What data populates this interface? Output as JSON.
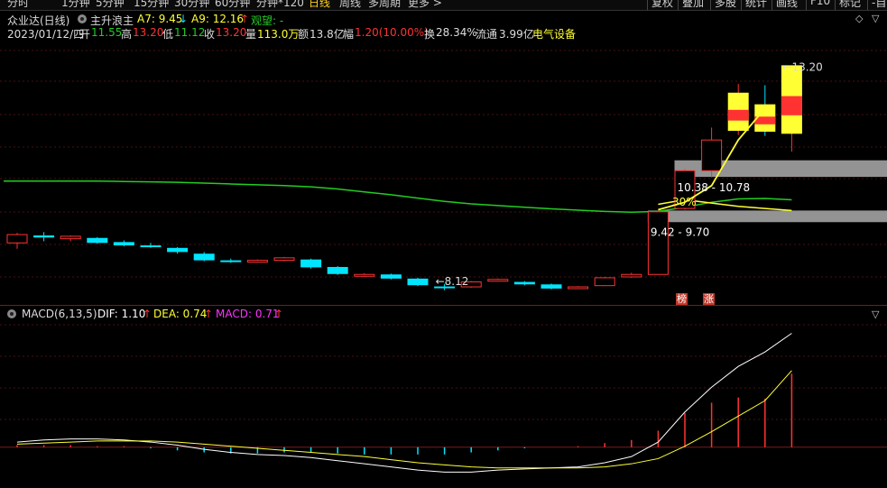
{
  "toolbar": {
    "tabs": [
      "分时",
      "1分钟",
      "5分钟",
      "15分钟",
      "30分钟",
      "60分钟",
      "分钟*120",
      "日线",
      "周线",
      "多周期",
      "更多 >"
    ],
    "active_tab": "日线",
    "right_buttons": [
      "复权",
      "叠加",
      "多股",
      "统计",
      "画线",
      "F10",
      "标记",
      "-自"
    ]
  },
  "header": {
    "stock_name": "众业达(日线)",
    "indicator_name": "主升浪主",
    "a7_label": "A7: 9.45",
    "a7_arrow": "↓",
    "a9_label": "A9: 12.16",
    "a9_arrow": "↑",
    "watch_label": "观望: -",
    "date": "2023/01/12/四",
    "open_label": "开",
    "open_value": "11.55",
    "high_label": "高",
    "high_value": "13.20",
    "low_label": "低",
    "low_value": "11.12",
    "close_label": "收",
    "close_value": "13.20",
    "volume_label": "量",
    "volume_value": "113.0万",
    "amount_label": "额",
    "amount_value": "13.8亿",
    "change_label": "幅",
    "change_value": "1.20(10.00%)",
    "turnover_label": "换",
    "turnover_value": "28.34%",
    "float_label": "流通",
    "float_value": "3.99亿",
    "sector": "电气设备"
  },
  "macd_header": {
    "name": "MACD(6,13,5)",
    "dif_label": "DIF: 1.10",
    "dif_arrow": "↑",
    "dea_label": "DEA: 0.74",
    "dea_arrow": "↑",
    "macd_label": "MACD: 0.71",
    "macd_arrow": "↑"
  },
  "badges": {
    "bang": "榜",
    "zhang": "涨"
  },
  "colors": {
    "up": "#ff3232",
    "down": "#00e5ff",
    "ma_line": "#22cc22",
    "signal_line": "#ffff33",
    "yellow_candle": "#ffff33",
    "band": "#9b9b9b",
    "dif": "#ffffff",
    "dea": "#ffff33",
    "macd_label": "#ff33ff"
  },
  "chart_data": [
    {
      "type": "candlestick",
      "title": "众业达(日线)",
      "ohlc": [
        {
          "o": 8.92,
          "h": 9.16,
          "l": 8.78,
          "c": 9.12
        },
        {
          "o": 9.1,
          "h": 9.18,
          "l": 8.96,
          "c": 9.05
        },
        {
          "o": 9.02,
          "h": 9.1,
          "l": 8.96,
          "c": 9.08
        },
        {
          "o": 9.04,
          "h": 9.06,
          "l": 8.9,
          "c": 8.92
        },
        {
          "o": 8.94,
          "h": 8.98,
          "l": 8.84,
          "c": 8.86
        },
        {
          "o": 8.86,
          "h": 8.92,
          "l": 8.8,
          "c": 8.82
        },
        {
          "o": 8.8,
          "h": 8.82,
          "l": 8.66,
          "c": 8.7
        },
        {
          "o": 8.66,
          "h": 8.7,
          "l": 8.48,
          "c": 8.5
        },
        {
          "o": 8.5,
          "h": 8.54,
          "l": 8.44,
          "c": 8.48
        },
        {
          "o": 8.48,
          "h": 8.52,
          "l": 8.45,
          "c": 8.5
        },
        {
          "o": 8.5,
          "h": 8.58,
          "l": 8.48,
          "c": 8.56
        },
        {
          "o": 8.52,
          "h": 8.54,
          "l": 8.3,
          "c": 8.33
        },
        {
          "o": 8.34,
          "h": 8.36,
          "l": 8.15,
          "c": 8.17
        },
        {
          "o": 8.13,
          "h": 8.19,
          "l": 8.1,
          "c": 8.16
        },
        {
          "o": 8.16,
          "h": 8.18,
          "l": 8.04,
          "c": 8.06
        },
        {
          "o": 8.06,
          "h": 8.08,
          "l": 7.88,
          "c": 7.9
        },
        {
          "o": 7.87,
          "h": 7.93,
          "l": 7.78,
          "c": 7.86
        },
        {
          "o": 7.86,
          "h": 8.0,
          "l": 7.84,
          "c": 7.98
        },
        {
          "o": 8.02,
          "h": 8.06,
          "l": 7.99,
          "c": 8.04
        },
        {
          "o": 7.98,
          "h": 8.0,
          "l": 7.9,
          "c": 7.92
        },
        {
          "o": 7.92,
          "h": 7.94,
          "l": 7.8,
          "c": 7.82
        },
        {
          "o": 7.84,
          "h": 7.88,
          "l": 7.82,
          "c": 7.86
        },
        {
          "o": 7.89,
          "h": 8.1,
          "l": 7.88,
          "c": 8.08
        },
        {
          "o": 8.1,
          "h": 8.2,
          "l": 8.08,
          "c": 8.16
        },
        {
          "o": 8.16,
          "h": 9.7,
          "l": 8.16,
          "c": 9.67
        },
        {
          "o": 9.75,
          "h": 10.7,
          "l": 9.72,
          "c": 10.66
        },
        {
          "o": 10.66,
          "h": 11.7,
          "l": 10.5,
          "c": 11.4
        },
        {
          "o": 11.62,
          "h": 12.75,
          "l": 11.52,
          "c": 12.54,
          "highlight": "yellow"
        },
        {
          "o": 12.26,
          "h": 12.72,
          "l": 11.5,
          "c": 11.6,
          "highlight": "yellow"
        },
        {
          "o": 11.55,
          "h": 13.2,
          "l": 11.12,
          "c": 13.2,
          "highlight": "yellow"
        }
      ],
      "ma_line": [
        10.41,
        10.41,
        10.41,
        10.41,
        10.4,
        10.39,
        10.38,
        10.36,
        10.34,
        10.32,
        10.3,
        10.27,
        10.22,
        10.15,
        10.08,
        10.0,
        9.92,
        9.86,
        9.82,
        9.78,
        9.74,
        9.71,
        9.68,
        9.66,
        9.68,
        9.78,
        9.9,
        9.98,
        9.99,
        9.96
      ],
      "signal_line": [
        {
          "i": 24,
          "v": 9.72
        },
        {
          "i": 25,
          "v": 9.9
        },
        {
          "i": 26,
          "v": 10.3
        },
        {
          "i": 27,
          "v": 11.4
        },
        {
          "i": 28,
          "v": 12.16
        }
      ],
      "signal_tail": [
        {
          "i": 24,
          "v": 9.85
        },
        {
          "i": 25,
          "v": 9.96
        },
        {
          "i": 26,
          "v": 9.88
        },
        {
          "i": 27,
          "v": 9.8
        },
        {
          "i": 28,
          "v": 9.75
        },
        {
          "i": 29,
          "v": 9.7
        }
      ],
      "bands": [
        {
          "low": 10.38,
          "high": 10.78,
          "label": "10.38 - 10.78",
          "from_index": 25
        },
        {
          "low": 9.42,
          "high": 9.7,
          "label": "9.42 - 9.70",
          "from_index": 24
        }
      ],
      "annotations": [
        {
          "text": "←8.12",
          "index": 16,
          "value": 8.12
        },
        {
          "text": "←13.20",
          "index": 29,
          "value": 13.2
        },
        {
          "text": "30%",
          "index": 25,
          "value": 9.9
        }
      ],
      "ylim": [
        7.6,
        13.6
      ]
    },
    {
      "type": "macd",
      "title": "MACD(6,13,5)",
      "dif": [
        0.05,
        0.07,
        0.08,
        0.08,
        0.07,
        0.05,
        0.02,
        -0.02,
        -0.05,
        -0.07,
        -0.08,
        -0.1,
        -0.13,
        -0.16,
        -0.19,
        -0.22,
        -0.24,
        -0.24,
        -0.22,
        -0.21,
        -0.2,
        -0.19,
        -0.15,
        -0.09,
        0.05,
        0.34,
        0.58,
        0.78,
        0.92,
        1.1
      ],
      "dea": [
        0.03,
        0.04,
        0.05,
        0.06,
        0.06,
        0.06,
        0.05,
        0.03,
        0.01,
        -0.01,
        -0.03,
        -0.05,
        -0.07,
        -0.09,
        -0.12,
        -0.15,
        -0.17,
        -0.19,
        -0.2,
        -0.2,
        -0.2,
        -0.2,
        -0.19,
        -0.16,
        -0.11,
        0.01,
        0.15,
        0.3,
        0.45,
        0.74
      ],
      "histogram": [
        0.02,
        0.02,
        0.02,
        0.01,
        0.01,
        -0.01,
        -0.03,
        -0.05,
        -0.06,
        -0.06,
        -0.05,
        -0.05,
        -0.06,
        -0.07,
        -0.07,
        -0.07,
        -0.07,
        -0.05,
        -0.03,
        -0.01,
        0.0,
        0.01,
        0.04,
        0.07,
        0.16,
        0.33,
        0.43,
        0.48,
        0.47,
        0.71
      ],
      "ylim": [
        -0.35,
        1.2
      ]
    }
  ]
}
